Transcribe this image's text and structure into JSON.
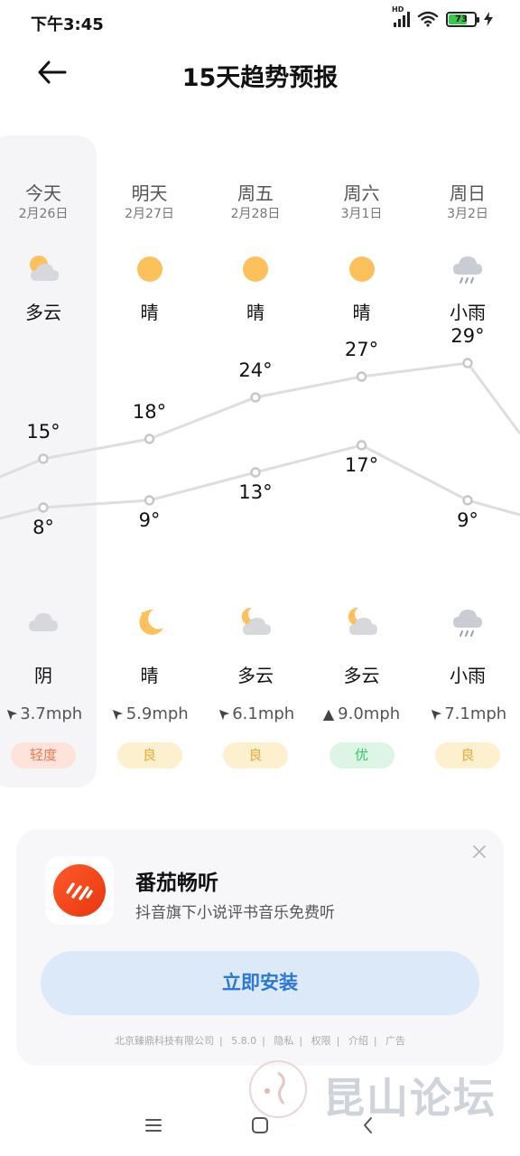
{
  "status": {
    "time": "下午3:45",
    "network": "HD",
    "battery": "73"
  },
  "header": {
    "title": "15天趋势预报"
  },
  "days": [
    {
      "day": "今天",
      "date": "2月26日",
      "day_icon": "partly-cloudy-icon",
      "day_cond": "多云",
      "high": "15°",
      "low": "8°",
      "night_icon": "cloud-icon",
      "night_cond": "阴",
      "wind": "3.7mph",
      "aqi": "轻度",
      "aqi_level": "light"
    },
    {
      "day": "明天",
      "date": "2月27日",
      "day_icon": "sun-icon",
      "day_cond": "晴",
      "high": "18°",
      "low": "9°",
      "night_icon": "moon-icon",
      "night_cond": "晴",
      "wind": "5.9mph",
      "aqi": "良",
      "aqi_level": "good"
    },
    {
      "day": "周五",
      "date": "2月28日",
      "day_icon": "sun-icon",
      "day_cond": "晴",
      "high": "24°",
      "low": "13°",
      "night_icon": "moon-cloud-icon",
      "night_cond": "多云",
      "wind": "6.1mph",
      "aqi": "良",
      "aqi_level": "good"
    },
    {
      "day": "周六",
      "date": "3月1日",
      "day_icon": "sun-icon",
      "day_cond": "晴",
      "high": "27°",
      "low": "17°",
      "night_icon": "moon-cloud-icon",
      "night_cond": "多云",
      "wind": "9.0mph",
      "aqi": "优",
      "aqi_level": "excellent"
    },
    {
      "day": "周日",
      "date": "3月2日",
      "day_icon": "rain-icon",
      "day_cond": "小雨",
      "high": "29°",
      "low": "9°",
      "night_icon": "rain-icon",
      "night_cond": "小雨",
      "wind": "7.1mph",
      "aqi": "良",
      "aqi_level": "good"
    }
  ],
  "temps": {
    "high": [
      15,
      18,
      24,
      27,
      29
    ],
    "low": [
      8,
      9,
      13,
      17,
      9
    ]
  },
  "colors": {
    "sun": "#fcc15a",
    "cloud": "#d6d8dc",
    "aqi_light_bg": "#fde3d9",
    "aqi_light_fg": "#ee7a55",
    "aqi_good_bg": "#fdf0cf",
    "aqi_good_fg": "#e9a83a",
    "aqi_excellent_bg": "#dcf5e4",
    "aqi_excellent_fg": "#3ec06a",
    "install_fg": "#2b78d6"
  },
  "ad": {
    "app_name": "番茄畅听",
    "description": "抖音旗下小说评书音乐免费听",
    "install_label": "立即安装",
    "meta": [
      "北京臻鼎科技有限公司",
      "5.8.0",
      "隐私",
      "权限",
      "介绍",
      "广告"
    ]
  },
  "watermark": {
    "text": "昆山论坛"
  }
}
